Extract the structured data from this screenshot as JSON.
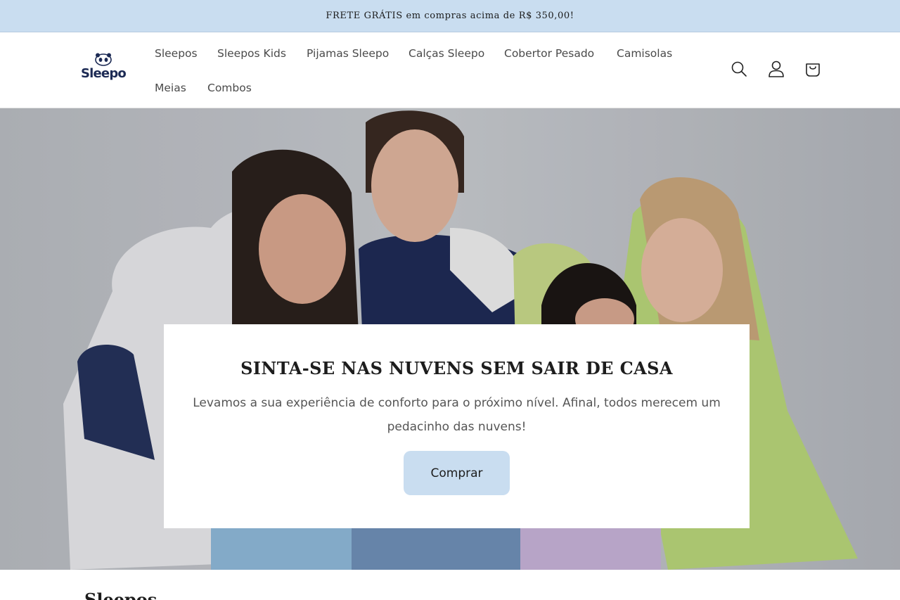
{
  "announcement": {
    "text": "FRETE GRÁTIS em compras acima de R$ 350,00!"
  },
  "header": {
    "logo_text": "Sleepo",
    "nav": [
      {
        "label": "Sleepos"
      },
      {
        "label": "Sleepos Kids"
      },
      {
        "label": "Pijamas Sleepo"
      },
      {
        "label": "Calças Sleepo"
      },
      {
        "label": "Cobertor Pesado"
      },
      {
        "label": "Camisolas"
      },
      {
        "label": "Meias"
      },
      {
        "label": "Combos"
      }
    ],
    "icons": [
      "search-icon",
      "account-icon",
      "cart-icon"
    ]
  },
  "hero": {
    "title": "SINTA-SE NAS NUVENS SEM SAIR DE CASA",
    "text": "Levamos a sua experiência de conforto para o próximo nível. Afinal, todos merecem um pedacinho das nuvens!",
    "button_label": "Comprar"
  },
  "section": {
    "title": "Sleepos"
  },
  "colors": {
    "announcement_bg": "#c9ddf0",
    "button_bg": "#c9ddf0",
    "logo": "#1c2a54"
  }
}
